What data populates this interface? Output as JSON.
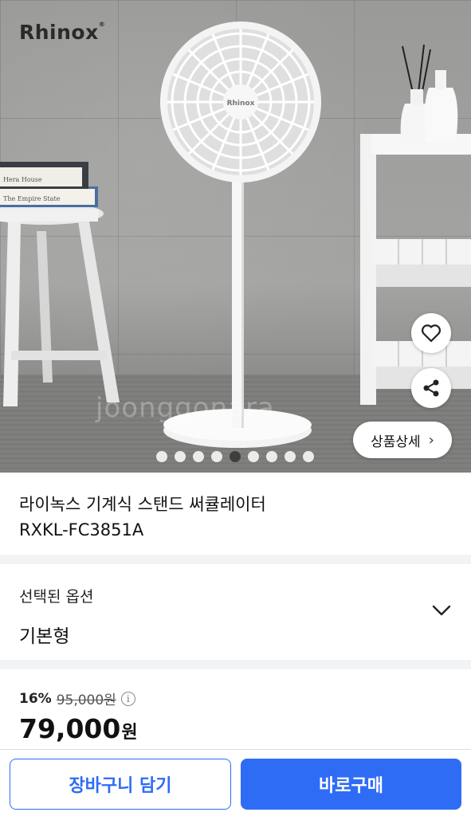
{
  "hero": {
    "brand_logo": "Rhinox",
    "fan_brand": "Rhinox",
    "watermark": "joonggonara",
    "detail_button_label": "상품상세",
    "image_count": 9,
    "active_image_index": 4,
    "book_titles": [
      "Hera House",
      "The Empire State"
    ]
  },
  "product": {
    "title_line1": "라이녹스 기계식 스탠드 써큘레이터",
    "title_line2": "RXKL-FC3851A"
  },
  "option": {
    "label": "선택된 옵션",
    "value": "기본형"
  },
  "price": {
    "discount": "16%",
    "original": "95,000원",
    "amount": "79,000",
    "currency": "원"
  },
  "actions": {
    "cart_label": "장바구니 담기",
    "buy_label": "바로구매"
  },
  "colors": {
    "primary": "#2f6cf6",
    "brand_red": "#d4361e"
  }
}
